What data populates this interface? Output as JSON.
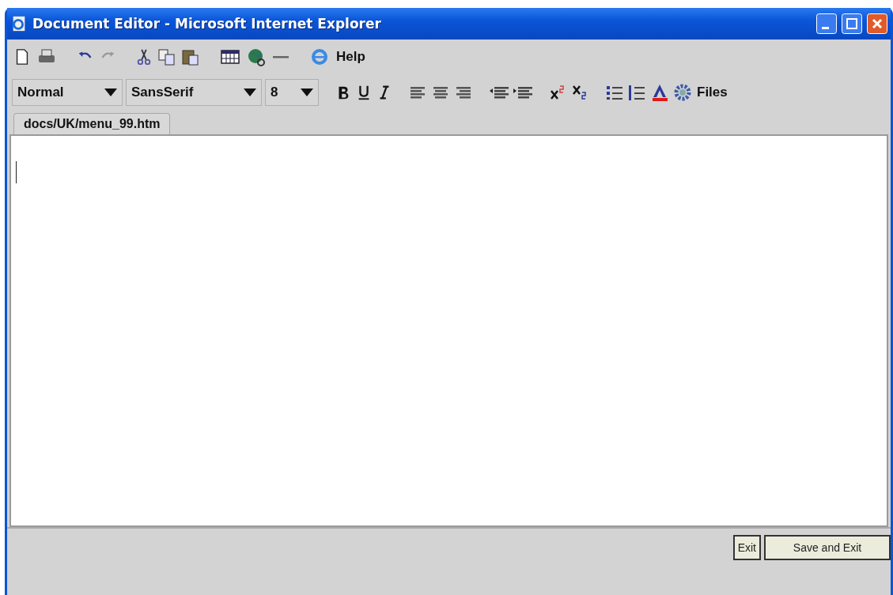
{
  "window": {
    "title": "Document Editor - Microsoft Internet Explorer"
  },
  "toolbar": {
    "help_label": "Help"
  },
  "format_bar": {
    "paragraph_style": "Normal",
    "font_family": "SansSerif",
    "font_size": "8",
    "files_label": "Files"
  },
  "tabs": [
    {
      "label": "docs/UK/menu_99.htm",
      "selected": true
    }
  ],
  "buttons": [
    "Exit",
    "Save and Exit"
  ]
}
